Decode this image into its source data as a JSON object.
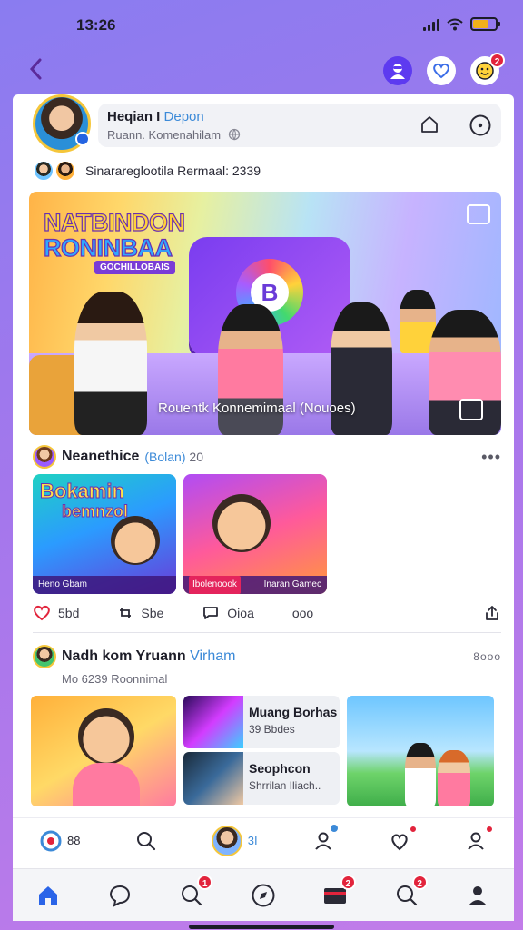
{
  "status_bar": {
    "time": "13:26"
  },
  "top_nav": {
    "notification_count": "2"
  },
  "profile": {
    "name": "Heqian I",
    "name_tag": "Depon",
    "subtitle": "Ruann. Komenahilam"
  },
  "group": {
    "text": "Sinarareglootila Rermaal: 2339"
  },
  "hero": {
    "title_line1": "NATBINDON",
    "title_line2": "RONINBAA",
    "subtitle": "GOCHILLOBAIS",
    "caption": "Rouentk Konnemimaal (Nouoes)"
  },
  "post1": {
    "name": "Neanethice",
    "tag": "(Bolan)",
    "meta": "20",
    "thumb1": {
      "title_line1": "Bokamin",
      "title_line2": "bemnzol",
      "bar_left": "Heno Gbam",
      "bar_right": ""
    },
    "thumb2": {
      "bar_left": "Ibolenoook",
      "bar_right": "Inaran Gamec"
    },
    "actions": {
      "likes": "5bd",
      "reposts": "Sbe",
      "comments": "Oioa",
      "more": "ooo"
    }
  },
  "post2": {
    "name": "Nadh kom Yruann",
    "tag": "Virham",
    "subtitle": "Mo 6239 Roonnimal",
    "dots": "8ooo",
    "item1": {
      "title": "Muang Borhas",
      "subtitle": "39 Bbdes"
    },
    "item2": {
      "title": "Seophcon",
      "subtitle": "Shrrilan Iliach.."
    }
  },
  "card_tabs": {
    "first_count": "88",
    "avatar_count": "3I"
  },
  "bottom_nav": {
    "badge_chat": "1",
    "badge_wallet": "2",
    "badge_search": "2"
  },
  "colors": {
    "accent": "#3c8ad8",
    "brand_purple": "#7a3cd6",
    "badge_red": "#e2243c"
  }
}
